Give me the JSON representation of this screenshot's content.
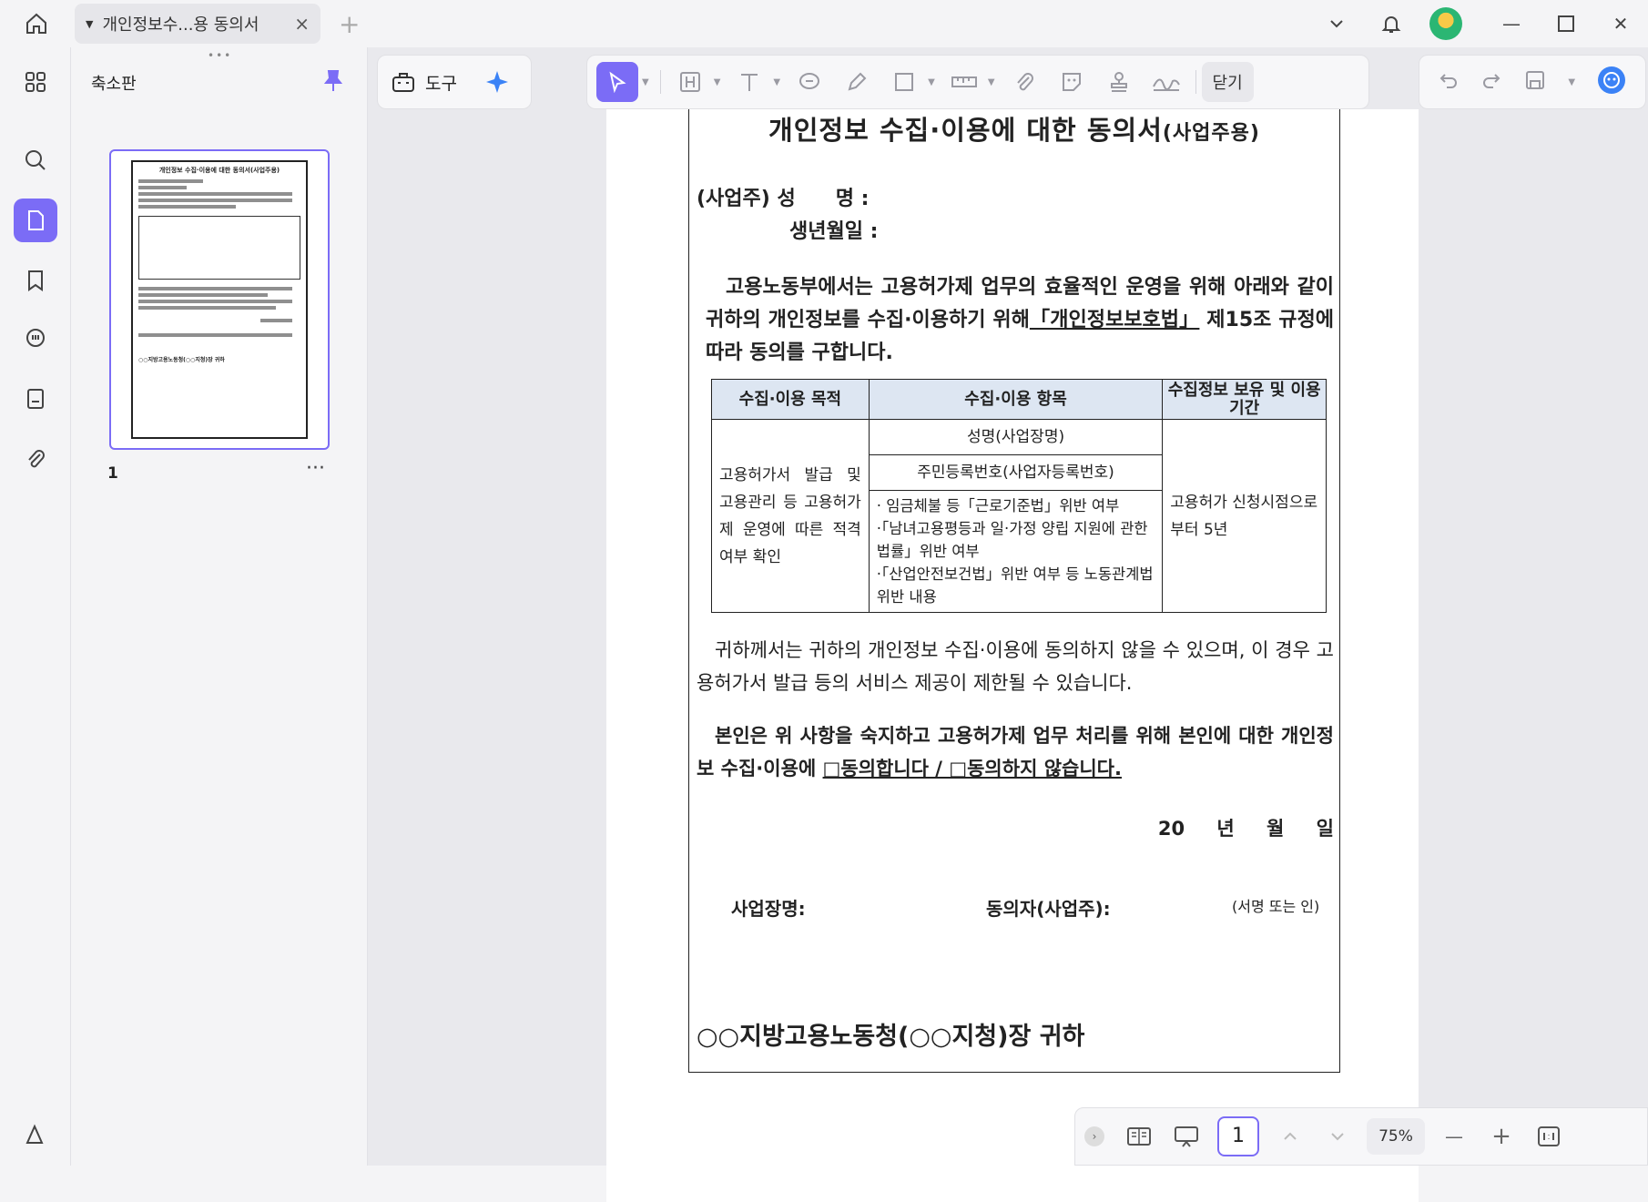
{
  "tab": {
    "title": "개인정보수...용 동의서"
  },
  "thumbnails": {
    "title": "축소판",
    "page_number": "1",
    "more": "···"
  },
  "thumb_text": {
    "title": "개인정보 수집·이용에 대한 동의서(사업주용)",
    "footer": "○○지방고용노동청(○○지청)장 귀하"
  },
  "toolbar": {
    "tools_label": "도구",
    "close_label": "닫기"
  },
  "document": {
    "title": "개인정보 수집·이용에 대한 동의서",
    "title_suffix": "(사업주용)",
    "field_name": "(사업주) 성　　명 :",
    "field_birth": "생년월일 :",
    "para1_before": "고용노동부에서는 고용허가제 업무의 효율적인 운영을 위해 아래와 같이 귀하의 개인정보를 수집·이용하기 위해",
    "para1_law": "「개인정보보호법」",
    "para1_after": "제15조 규정에 따라 동의를 구합니다.",
    "table": {
      "headers": [
        "수집·이용 목적",
        "수집·이용 항목",
        "수집정보 보유 및 이용기간"
      ],
      "purpose": "고용허가서 발급 및 고용관리 등 고용허가제 운영에 따른 적격여부 확인",
      "items": [
        "성명(사업장명)",
        "주민등록번호(사업자등록번호)"
      ],
      "list": [
        "· 임금체불 등「근로기준법」위반 여부",
        "·「남녀고용평등과 일·가정 양립 지원에 관한 법률」위반 여부",
        "·「산업안전보건법」위반 여부 등 노동관계법 위반 내용"
      ],
      "period": "고용허가 신청시점으로부터 5년"
    },
    "para2": "귀하께서는 귀하의 개인정보 수집·이용에 동의하지 않을 수 있으며, 이 경우 고용허가서 발급 등의 서비스 제공이 제한될 수 있습니다.",
    "para3_before": "본인은 위 사항을 숙지하고 고용허가제 업무 처리를 위해 본인에 대한 개인정보 수집·이용에",
    "para3_choice": "□동의합니다 / □동의하지 않습니다.",
    "date": "20 년 월 일",
    "sign_company": "사업장명:",
    "sign_agree": "동의자(사업주):",
    "sign_note": "(서명 또는 인)",
    "footer": "○○지방고용노동청(○○지청)장 귀하"
  },
  "bottom": {
    "page": "1",
    "zoom": "75%"
  }
}
